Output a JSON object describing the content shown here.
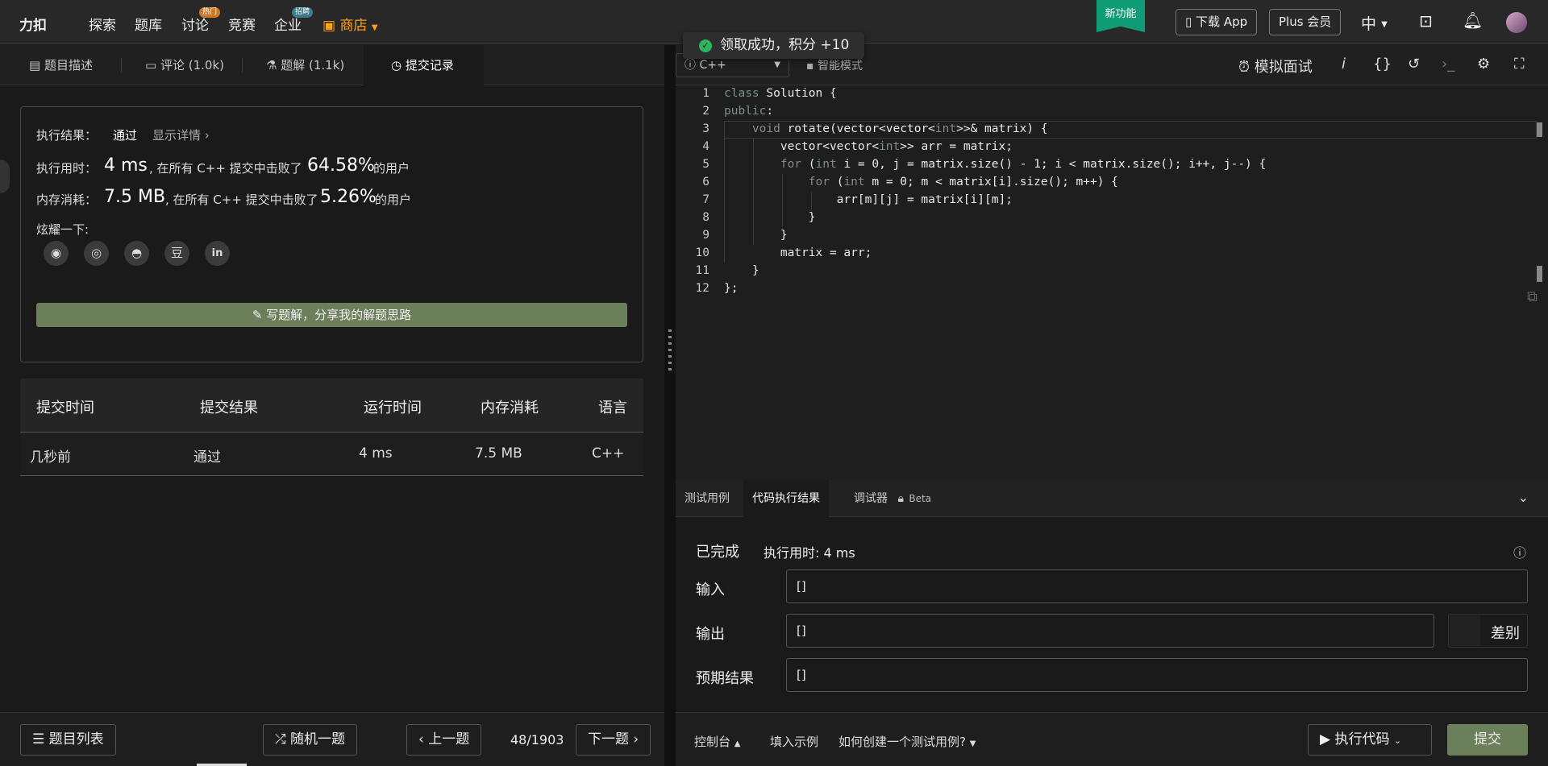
{
  "nav": {
    "logo": "力扣",
    "items": [
      "探索",
      "题库",
      "讨论",
      "竞赛",
      "企业"
    ],
    "discuss_badge": "热门",
    "enterprise_badge": "招聘",
    "shop": "商店",
    "new_feature": "新功能",
    "download_app": "下载 App",
    "plus": "Plus 会员",
    "lang": "中"
  },
  "toast": "领取成功，积分 +10",
  "tabs": {
    "description": "题目描述",
    "comments": "评论 (1.0k)",
    "solutions": "题解 (1.1k)",
    "submissions": "提交记录"
  },
  "result": {
    "exec_label": "执行结果：",
    "status": "通过",
    "details": "显示详情 ›",
    "time_label": "执行用时：",
    "time_value": "4 ms",
    "time_mid": ", 在所有 C++ 提交中击败了",
    "time_pct": "64.58%",
    "users": "的用户",
    "mem_label": "内存消耗：",
    "mem_value": "7.5 MB",
    "mem_mid": ", 在所有 C++ 提交中击败了",
    "mem_pct": "5.26%",
    "share_label": "炫耀一下:",
    "write_solution": "写题解，分享我的解题思路"
  },
  "table": {
    "headers": [
      "提交时间",
      "提交结果",
      "运行时间",
      "内存消耗",
      "语言"
    ],
    "row": [
      "几秒前",
      "通过",
      "4 ms",
      "7.5 MB",
      "C++"
    ]
  },
  "editor": {
    "language": "C++",
    "mode": "智能模式",
    "mock_interview": "模拟面试",
    "line_numbers": [
      "1",
      "2",
      "3",
      "4",
      "5",
      "6",
      "7",
      "8",
      "9",
      "10",
      "11",
      "12"
    ]
  },
  "console": {
    "tabs": [
      "测试用例",
      "代码执行结果",
      "调试器"
    ],
    "beta": "Beta",
    "done": "已完成",
    "exec_time": "执行用时: 4 ms",
    "input_label": "输入",
    "input_value": "[]",
    "output_label": "输出",
    "output_value": "[]",
    "diff": "差别",
    "expected_label": "预期结果",
    "expected_value": "[]"
  },
  "footer": {
    "problem_list": "题目列表",
    "random": "随机一题",
    "prev": "上一题",
    "counter": "48/1903",
    "next": "下一题",
    "console": "控制台",
    "fill_example": "填入示例",
    "how_create": "如何创建一个测试用例?",
    "run": "执行代码",
    "submit": "提交"
  },
  "colors": {
    "accent_green": "#6c7f5b",
    "new_feature_bg": "#0f9d75",
    "shop_orange": "#ffa116"
  }
}
